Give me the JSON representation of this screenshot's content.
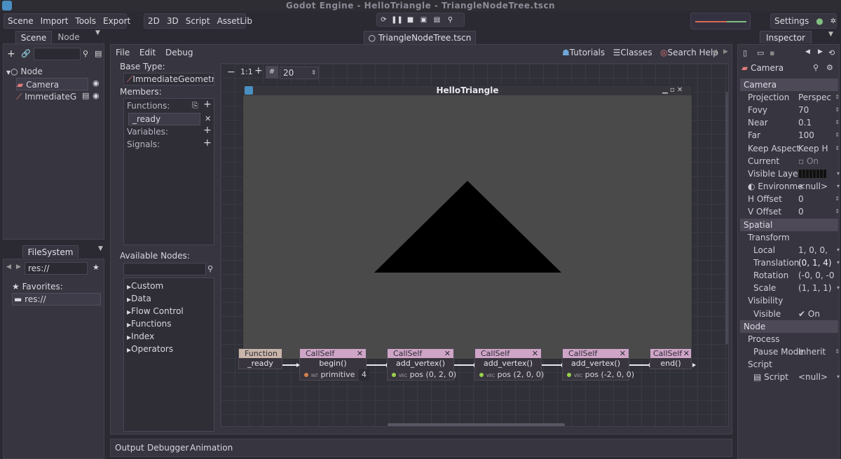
{
  "window": {
    "title": "Godot Engine - HelloTriangle - TriangleNodeTree.tscn"
  },
  "menu": {
    "scene": "Scene",
    "import": "Import",
    "tools": "Tools",
    "export": "Export"
  },
  "modes": {
    "m2d": "2D",
    "m3d": "3D",
    "script": "Script",
    "assetlib": "AssetLib"
  },
  "playbar": {
    "icons": [
      "loop-icon",
      "pause-icon",
      "stop-icon",
      "play-scene-icon",
      "play-custom-icon",
      "deploy-icon"
    ]
  },
  "settings": {
    "label": "Settings"
  },
  "scene_dock": {
    "tabs": [
      "Scene",
      "Node"
    ],
    "tree": [
      {
        "label": "Node",
        "icon": "circle-icon"
      },
      {
        "label": "Camera",
        "icon": "camera-icon"
      },
      {
        "label": "ImmediateG",
        "icon": "immediate-geometry-icon"
      }
    ]
  },
  "filesystem": {
    "tab": "FileSystem",
    "path": "res://",
    "favorites": "Favorites:",
    "items": [
      "res://"
    ]
  },
  "editor_tab": {
    "label": "TriangleNodeTree.tscn"
  },
  "script_menu": {
    "file": "File",
    "edit": "Edit",
    "debug": "Debug"
  },
  "help_links": {
    "tutorials": "Tutorials",
    "classes": "Classes",
    "search": "Search Help"
  },
  "vs_sidebar": {
    "base_type_label": "Base Type:",
    "base_type_value": "ImmediateGeometry",
    "members_label": "Members:",
    "functions": "Functions:",
    "ready": "_ready",
    "variables": "Variables:",
    "signals": "Signals:",
    "available_nodes": "Available Nodes:",
    "categories": [
      "Custom",
      "Data",
      "Flow Control",
      "Functions",
      "Index",
      "Operators"
    ]
  },
  "graph_toolbar": {
    "zoom": "20"
  },
  "game_window": {
    "title": "HelloTriangle"
  },
  "nodes": {
    "function": {
      "header": "Function",
      "name": "_ready"
    },
    "callself_label": "CallSelf",
    "begin": {
      "call": "begin()",
      "port": "primitive",
      "value": "4"
    },
    "v1": {
      "call": "add_vertex()",
      "port": "pos",
      "value": "(0, 2, 0)"
    },
    "v2": {
      "call": "add_vertex()",
      "port": "pos",
      "value": "(2, 0, 0)"
    },
    "v3": {
      "call": "add_vertex()",
      "port": "pos",
      "value": "(-2, 0, 0)"
    },
    "end": {
      "call": "end()",
      "header": "CallSelf"
    }
  },
  "bottom_tabs": {
    "output": "Output",
    "debugger": "Debugger",
    "animation": "Animation"
  },
  "inspector": {
    "tab": "Inspector",
    "object": "Camera",
    "sections": {
      "camera": "Camera",
      "spatial": "Spatial",
      "node": "Node"
    },
    "rows": {
      "projection": {
        "label": "Projection",
        "value": "Perspec"
      },
      "fovy": {
        "label": "Fovy",
        "value": "70"
      },
      "near": {
        "label": "Near",
        "value": "0.1"
      },
      "far": {
        "label": "Far",
        "value": "100"
      },
      "keep_aspect": {
        "label": "Keep Aspect",
        "value": "Keep H"
      },
      "current": {
        "label": "Current",
        "value": "On"
      },
      "visible_layers": {
        "label": "Visible Layers"
      },
      "environment": {
        "label": "Environme",
        "value": "<null>"
      },
      "h_offset": {
        "label": "H Offset",
        "value": "0"
      },
      "v_offset": {
        "label": "V Offset",
        "value": "0"
      },
      "transform": {
        "label": "Transform"
      },
      "local": {
        "label": "Local",
        "value": "1, 0, 0,"
      },
      "translation": {
        "label": "Translation",
        "value": "(0, 1, 4)"
      },
      "rotation": {
        "label": "Rotation",
        "value": "(-0, 0, -0"
      },
      "scale": {
        "label": "Scale",
        "value": "(1, 1, 1)"
      },
      "visibility": {
        "label": "Visibility"
      },
      "visible": {
        "label": "Visible",
        "value": "On"
      },
      "process": {
        "label": "Process"
      },
      "pause_mode": {
        "label": "Pause Mode",
        "value": "Inherit"
      },
      "script_group": {
        "label": "Script"
      },
      "script": {
        "label": "Script",
        "value": "<null>"
      }
    }
  },
  "colors": {
    "accent": "#cfa5c7",
    "bg": "#2b2a33",
    "panel": "#37353f",
    "viewport": "#4a4a4a"
  }
}
